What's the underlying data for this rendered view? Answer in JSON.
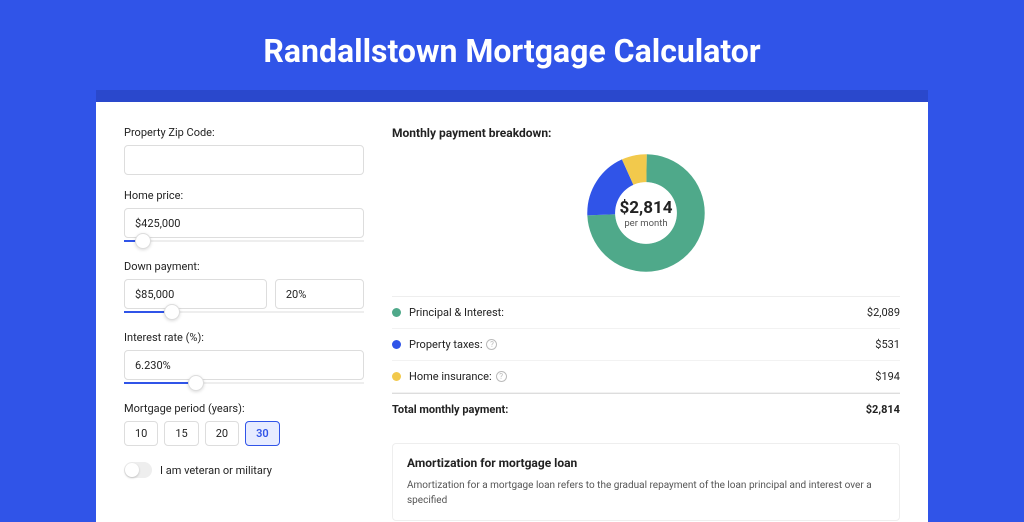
{
  "title": "Randallstown Mortgage Calculator",
  "form": {
    "zip": {
      "label": "Property Zip Code:",
      "value": ""
    },
    "price": {
      "label": "Home price:",
      "value": "$425,000",
      "slider_pct": 8
    },
    "down": {
      "label": "Down payment:",
      "amount": "$85,000",
      "pct": "20%",
      "slider_pct": 20
    },
    "rate": {
      "label": "Interest rate (%):",
      "value": "6.230%",
      "slider_pct": 30
    },
    "period": {
      "label": "Mortgage period (years):",
      "options": [
        "10",
        "15",
        "20",
        "30"
      ],
      "active": "30"
    },
    "veteran": {
      "label": "I am veteran or military"
    }
  },
  "chart_data": {
    "type": "pie",
    "title": "Monthly payment breakdown:",
    "center_value": "$2,814",
    "center_sub": "per month",
    "series": [
      {
        "name": "Principal & Interest:",
        "value": 2089,
        "display": "$2,089",
        "color": "#4fa98a"
      },
      {
        "name": "Property taxes:",
        "value": 531,
        "display": "$531",
        "color": "#3054e8",
        "help": true
      },
      {
        "name": "Home insurance:",
        "value": 194,
        "display": "$194",
        "color": "#f2c94c",
        "help": true
      }
    ],
    "total": {
      "label": "Total monthly payment:",
      "display": "$2,814"
    }
  },
  "amort": {
    "title": "Amortization for mortgage loan",
    "text": "Amortization for a mortgage loan refers to the gradual repayment of the loan principal and interest over a specified"
  }
}
